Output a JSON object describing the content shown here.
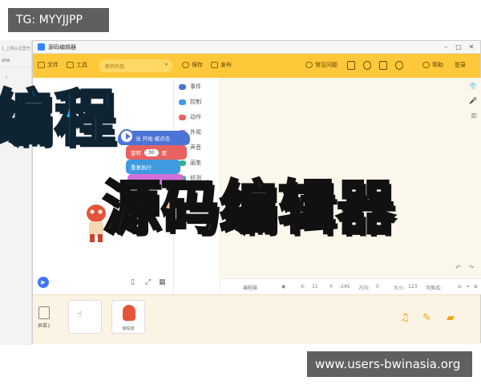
{
  "watermark_top": "TG: MYYJJPP",
  "watermark_bottom": "www.users-bwinasia.org",
  "overlay": {
    "line1": "编程",
    "line2": "源码编辑器"
  },
  "browser": {
    "tab_text": "1_上网从这里开",
    "address_text": "she"
  },
  "window": {
    "title": "源码编辑器"
  },
  "toolbar": {
    "file": "文件",
    "tools": "工具",
    "project_name": "新的作品",
    "save": "保存",
    "publish": "发布",
    "faq": "常见问题",
    "help": "帮助",
    "login": "登录"
  },
  "categories": [
    {
      "label": "事件",
      "color": "#4c73d6"
    },
    {
      "label": "控制",
      "color": "#3f9ae0"
    },
    {
      "label": "动作",
      "color": "#e6615f"
    },
    {
      "label": "外观",
      "color": "#d070d8"
    },
    {
      "label": "声音",
      "color": "#a66de0"
    },
    {
      "label": "画笔",
      "color": "#2fb38a"
    },
    {
      "label": "侦测",
      "color": "#2fb38a"
    }
  ],
  "blocks": {
    "event": "当 开始 被点击",
    "rotate_pre": "旋转",
    "rotate_val": "30",
    "rotate_post": "度",
    "repeat": "重复执行"
  },
  "code_status": {
    "label": "编程猫",
    "x_label": "X:",
    "x_val": "11",
    "y_label": "Y:",
    "y_val": "-245",
    "dir_label": "方向:",
    "dir_val": "0",
    "size_label": "大小:",
    "size_val": "123",
    "visible_label": "可换成:"
  },
  "tray": {
    "screen_label": "屏幕1",
    "sprite_label": "编程猫"
  }
}
